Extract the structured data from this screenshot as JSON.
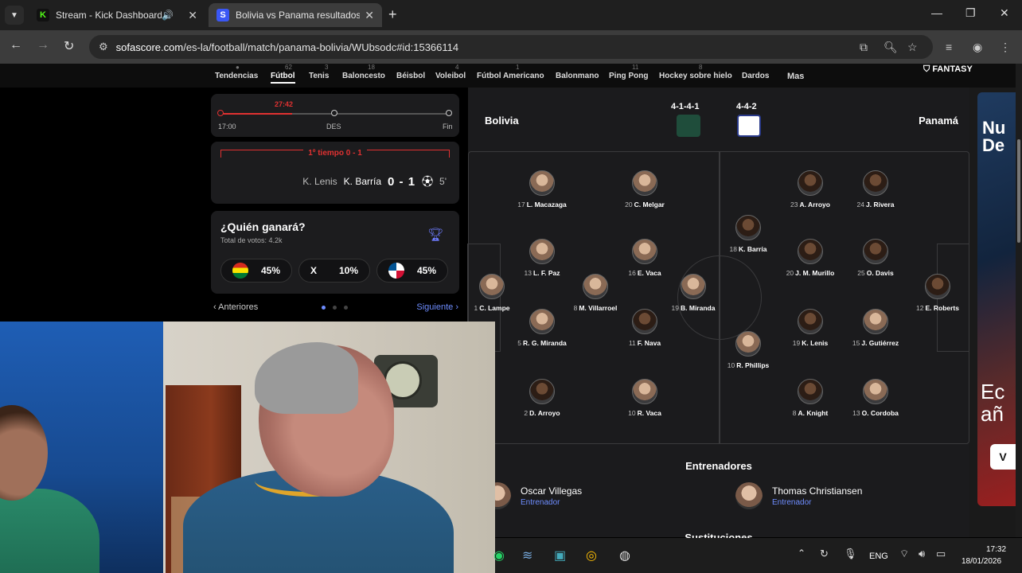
{
  "browser": {
    "tabs": [
      {
        "title": "Stream - Kick Dashboard",
        "favicon": "kick-icon"
      },
      {
        "title": "Bolivia vs Panama resultados en",
        "favicon": "sofascore-icon"
      }
    ],
    "url_host": "sofascore.com",
    "url_path": "/es-la/football/match/panama-bolivia/WUbsodc#id:15366114"
  },
  "sports_nav": {
    "items": [
      "Tendencias",
      "Fútbol",
      "Tenis",
      "Baloncesto",
      "Béisbol",
      "Voleibol",
      "Fútbol Americano",
      "Balonmano",
      "Ping Pong",
      "Hockey sobre hielo",
      "Dardos",
      "Mas"
    ],
    "icon_counts": [
      "62",
      "3",
      "18",
      "4",
      "1",
      "11",
      "8"
    ],
    "fantasy": "FANTASY"
  },
  "timeline": {
    "live_time": "27:42",
    "start": "17:00",
    "break": "DES",
    "end": "Fin",
    "progress": 0.31
  },
  "goals": {
    "half_label": "1º tiempo 0 - 1",
    "assist": "K. Lenis",
    "scorer": "K. Barría",
    "score": "0 - 1",
    "minute": "5'"
  },
  "vote": {
    "question": "¿Quién ganará?",
    "total": "Total de votos: 4.2k",
    "home_pct": "45%",
    "draw_label": "X",
    "draw_pct": "10%",
    "away_pct": "45%"
  },
  "pager": {
    "prev": "Anteriores",
    "next": "Siguiente"
  },
  "lineups": {
    "home": {
      "name": "Bolivia",
      "formation": "4-1-4-1",
      "jersey_color": "#1f4d3b",
      "players": [
        {
          "num": "1",
          "name": "C. Lampe"
        },
        {
          "num": "17",
          "name": "L. Macazaga"
        },
        {
          "num": "13",
          "name": "L. F. Paz"
        },
        {
          "num": "5",
          "name": "R. G. Miranda"
        },
        {
          "num": "2",
          "name": "D. Arroyo"
        },
        {
          "num": "8",
          "name": "M. Villarroel"
        },
        {
          "num": "20",
          "name": "C. Melgar"
        },
        {
          "num": "16",
          "name": "E. Vaca"
        },
        {
          "num": "11",
          "name": "F. Nava"
        },
        {
          "num": "10",
          "name": "R. Vaca"
        },
        {
          "num": "19",
          "name": "B. Miranda"
        }
      ]
    },
    "away": {
      "name": "Panamá",
      "formation": "4-4-2",
      "jersey_color": "#ffffff",
      "players": [
        {
          "num": "18",
          "name": "K. Barría"
        },
        {
          "num": "10",
          "name": "R. Phillips"
        },
        {
          "num": "23",
          "name": "A. Arroyo"
        },
        {
          "num": "20",
          "name": "J. M. Murillo"
        },
        {
          "num": "19",
          "name": "K. Lenis"
        },
        {
          "num": "8",
          "name": "A. Knight"
        },
        {
          "num": "24",
          "name": "J. Rivera"
        },
        {
          "num": "25",
          "name": "O. Davis"
        },
        {
          "num": "15",
          "name": "J. Gutiérrez"
        },
        {
          "num": "13",
          "name": "O. Cordoba"
        },
        {
          "num": "12",
          "name": "E. Roberts"
        }
      ]
    }
  },
  "coaches": {
    "title": "Entrenadores",
    "home": {
      "name": "Oscar Villegas",
      "role": "Entrenador"
    },
    "away": {
      "name": "Thomas Christiansen",
      "role": "Entrenador"
    }
  },
  "substitutions_title": "Sustituciones",
  "ad": {
    "text1": "Nu\nDe",
    "text2": "Ec\nañ",
    "button": "V"
  },
  "taskbar": {
    "lang": "ENG",
    "time": "17:32",
    "date": "18/01/2026"
  }
}
